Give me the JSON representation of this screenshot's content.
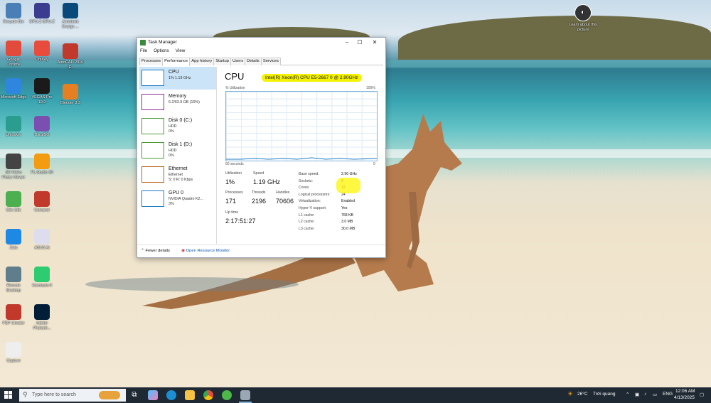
{
  "desktop": {
    "icons_col1": [
      "Recycle Bin",
      "Google Chrome",
      "Microsoft Edge",
      "Unlocker",
      "3D Video Photo Viewer",
      "Cốc Cốc",
      "Zalo",
      "Remote Desktop",
      "PDF Creator",
      "Capture"
    ],
    "icons_col2": [
      "GPU-Z GPU-Z",
      "UniKey",
      "VEGAS Pro 19.0",
      "UltraISO",
      "FL Studio 20",
      "Ccleaner",
      "ASUS Ai",
      "Camtasia 9",
      "Adobe Photosh..."
    ],
    "icons_col3": [
      "Autodesk Design ...",
      "AutoCAD 2010 - E...",
      "Blender 3.3"
    ],
    "learn_about": "Learn about this picture"
  },
  "task_manager": {
    "title": "Task Manager",
    "menu": [
      "File",
      "Options",
      "View"
    ],
    "tabs": [
      "Processes",
      "Performance",
      "App history",
      "Startup",
      "Users",
      "Details",
      "Services"
    ],
    "active_tab": "Performance",
    "sidebar": [
      {
        "name": "CPU",
        "line1": "1% 1.19 GHz",
        "line2": "",
        "line3": ""
      },
      {
        "name": "Memory",
        "line1": "6.2/63.9 GB (10%)",
        "line2": "",
        "line3": ""
      },
      {
        "name": "Disk 0 (C:)",
        "line1": "HDD",
        "line2": "0%",
        "line3": ""
      },
      {
        "name": "Disk 1 (D:)",
        "line1": "HDD",
        "line2": "0%",
        "line3": ""
      },
      {
        "name": "Ethernet",
        "line1": "Ethernet",
        "line2": "S: 0 R: 0 Kbps",
        "line3": ""
      },
      {
        "name": "GPU 0",
        "line1": "NVIDIA Quadro K2...",
        "line2": "3%",
        "line3": ""
      }
    ],
    "main": {
      "title": "CPU",
      "model": "Intel(R) Xeon(R) CPU E5-2667 0 @ 2.90GHz",
      "util_label": "% Utilization",
      "util_max": "100%",
      "time_label": "60 seconds",
      "time_end": "0",
      "stats": {
        "utilization_label": "Utilization",
        "utilization": "1%",
        "speed_label": "Speed",
        "speed": "1.19 GHz",
        "processes_label": "Processes",
        "processes": "171",
        "threads_label": "Threads",
        "threads": "2196",
        "handles_label": "Handles",
        "handles": "70606",
        "uptime_label": "Up time",
        "uptime": "2:17:51:27"
      },
      "details": [
        {
          "k": "Base speed:",
          "v": "2.90 GHz"
        },
        {
          "k": "Sockets:",
          "v": "2"
        },
        {
          "k": "Cores:",
          "v": "12"
        },
        {
          "k": "Logical processors:",
          "v": "24"
        },
        {
          "k": "Virtualization:",
          "v": "Enabled"
        },
        {
          "k": "Hyper-V support:",
          "v": "Yes"
        },
        {
          "k": "L1 cache:",
          "v": "768 KB"
        },
        {
          "k": "L2 cache:",
          "v": "3.0 MB"
        },
        {
          "k": "L3 cache:",
          "v": "30.0 MB"
        }
      ]
    },
    "footer": {
      "fewer": "Fewer details",
      "open_monitor": "Open Resource Monitor"
    }
  },
  "taskbar": {
    "search_placeholder": "Type here to search",
    "weather": "26°C",
    "weather_desc": "Trời quang",
    "lang": "ENG",
    "time": "12:06 AM",
    "date": "4/13/2025"
  }
}
